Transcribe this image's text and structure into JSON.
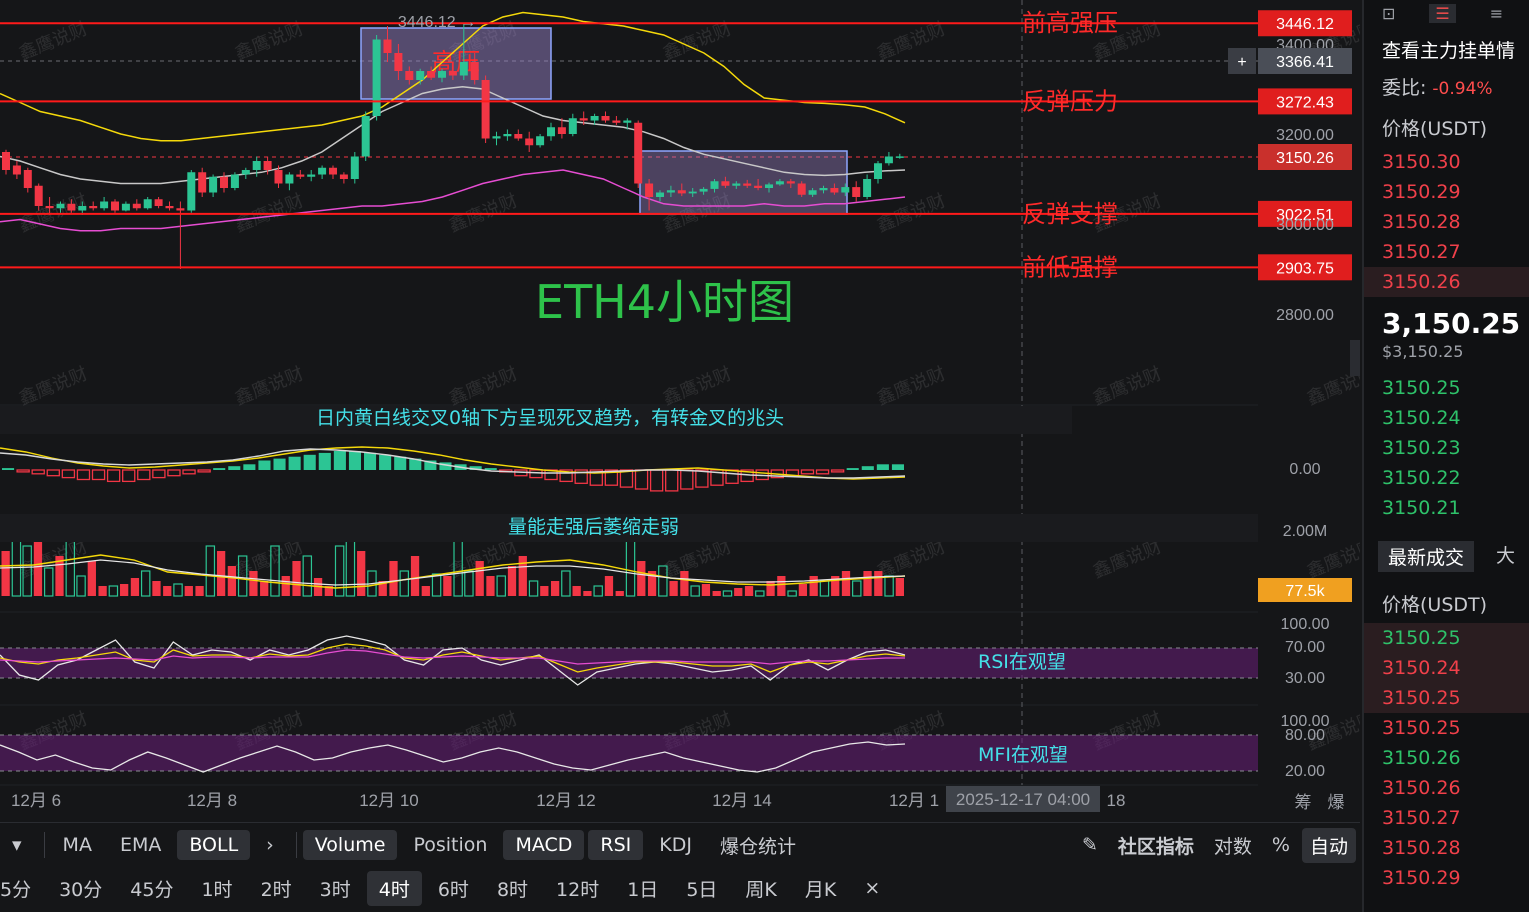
{
  "chart_data": {
    "type": "candlestick",
    "title": "ETH4小时图",
    "price_axis": {
      "ticks": [
        "3400.00",
        "3200.00",
        "3000.00",
        "2800.00"
      ]
    },
    "levels": [
      {
        "label": "前高强压",
        "price": 3446.12,
        "price_text": "3446.12"
      },
      {
        "label": "反弹压力",
        "price": 3272.43,
        "price_text": "3272.43"
      },
      {
        "label": "反弹支撑",
        "price": 3022.51,
        "price_text": "3022.51"
      },
      {
        "label": "前低强撑",
        "price": 2903.75,
        "price_text": "2903.75"
      }
    ],
    "current_price": "3150.26",
    "crosshair_price": "3366.41",
    "high_marker": "3446.12",
    "zones": [
      {
        "label": "高压"
      }
    ],
    "candles": [
      [
        3160,
        3165,
        3110,
        3120
      ],
      [
        3130,
        3140,
        3100,
        3110
      ],
      [
        3120,
        3125,
        3070,
        3080
      ],
      [
        3085,
        3090,
        3030,
        3040
      ],
      [
        3040,
        3060,
        3020,
        3035
      ],
      [
        3035,
        3050,
        3025,
        3045
      ],
      [
        3045,
        3055,
        3025,
        3030
      ],
      [
        3030,
        3050,
        3020,
        3040
      ],
      [
        3040,
        3050,
        3030,
        3035
      ],
      [
        3035,
        3060,
        3030,
        3050
      ],
      [
        3050,
        3055,
        3025,
        3030
      ],
      [
        3030,
        3050,
        3028,
        3045
      ],
      [
        3045,
        3055,
        3030,
        3035
      ],
      [
        3035,
        3060,
        3032,
        3055
      ],
      [
        3055,
        3060,
        3035,
        3040
      ],
      [
        3040,
        3050,
        3030,
        3035
      ],
      [
        3035,
        3050,
        2900,
        3030
      ],
      [
        3030,
        3120,
        3025,
        3115
      ],
      [
        3115,
        3125,
        3060,
        3070
      ],
      [
        3070,
        3110,
        3060,
        3105
      ],
      [
        3105,
        3115,
        3070,
        3080
      ],
      [
        3080,
        3115,
        3075,
        3110
      ],
      [
        3110,
        3125,
        3100,
        3120
      ],
      [
        3120,
        3150,
        3105,
        3140
      ],
      [
        3140,
        3150,
        3110,
        3120
      ],
      [
        3120,
        3130,
        3080,
        3090
      ],
      [
        3090,
        3115,
        3075,
        3110
      ],
      [
        3110,
        3120,
        3100,
        3105
      ],
      [
        3105,
        3120,
        3095,
        3110
      ],
      [
        3110,
        3130,
        3100,
        3125
      ],
      [
        3125,
        3130,
        3100,
        3110
      ],
      [
        3110,
        3115,
        3090,
        3100
      ],
      [
        3100,
        3160,
        3090,
        3150
      ],
      [
        3150,
        3250,
        3140,
        3240
      ],
      [
        3240,
        3420,
        3230,
        3410
      ],
      [
        3410,
        3440,
        3360,
        3380
      ],
      [
        3380,
        3400,
        3320,
        3340
      ],
      [
        3340,
        3350,
        3310,
        3320
      ],
      [
        3320,
        3345,
        3310,
        3340
      ],
      [
        3340,
        3350,
        3320,
        3325
      ],
      [
        3325,
        3345,
        3315,
        3340
      ],
      [
        3340,
        3360,
        3320,
        3330
      ],
      [
        3330,
        3446,
        3320,
        3360
      ],
      [
        3360,
        3380,
        3310,
        3320
      ],
      [
        3320,
        3330,
        3180,
        3190
      ],
      [
        3190,
        3205,
        3175,
        3195
      ],
      [
        3195,
        3210,
        3185,
        3200
      ],
      [
        3200,
        3210,
        3185,
        3190
      ],
      [
        3190,
        3205,
        3160,
        3175
      ],
      [
        3175,
        3200,
        3170,
        3195
      ],
      [
        3195,
        3225,
        3185,
        3215
      ],
      [
        3215,
        3235,
        3190,
        3200
      ],
      [
        3200,
        3245,
        3195,
        3235
      ],
      [
        3235,
        3250,
        3220,
        3230
      ],
      [
        3230,
        3245,
        3220,
        3240
      ],
      [
        3240,
        3250,
        3225,
        3230
      ],
      [
        3230,
        3240,
        3220,
        3225
      ],
      [
        3225,
        3235,
        3210,
        3230
      ],
      [
        3225,
        3230,
        3080,
        3090
      ],
      [
        3090,
        3100,
        3030,
        3060
      ],
      [
        3060,
        3075,
        3050,
        3070
      ],
      [
        3070,
        3085,
        3060,
        3075
      ],
      [
        3075,
        3090,
        3062,
        3068
      ],
      [
        3068,
        3080,
        3060,
        3072
      ],
      [
        3072,
        3082,
        3065,
        3078
      ],
      [
        3078,
        3100,
        3070,
        3095
      ],
      [
        3095,
        3105,
        3080,
        3085
      ],
      [
        3085,
        3095,
        3078,
        3090
      ],
      [
        3090,
        3098,
        3080,
        3085
      ],
      [
        3085,
        3100,
        3075,
        3080
      ],
      [
        3080,
        3092,
        3070,
        3088
      ],
      [
        3088,
        3100,
        3085,
        3095
      ],
      [
        3095,
        3100,
        3080,
        3090
      ],
      [
        3090,
        3095,
        3060,
        3065
      ],
      [
        3065,
        3080,
        3060,
        3075
      ],
      [
        3075,
        3085,
        3068,
        3080
      ],
      [
        3080,
        3090,
        3065,
        3070
      ],
      [
        3070,
        3090,
        3062,
        3082
      ],
      [
        3082,
        3095,
        3050,
        3060
      ],
      [
        3060,
        3110,
        3055,
        3100
      ],
      [
        3100,
        3140,
        3090,
        3135
      ],
      [
        3135,
        3160,
        3130,
        3150
      ],
      [
        3150,
        3156,
        3145,
        3150.26
      ]
    ],
    "boll_upper": [
      3290,
      3270,
      3250,
      3240,
      3230,
      3215,
      3200,
      3190,
      3185,
      3185,
      3190,
      3195,
      3200,
      3205,
      3210,
      3215,
      3220,
      3230,
      3240,
      3260,
      3290,
      3320,
      3360,
      3400,
      3440,
      3460,
      3470,
      3465,
      3460,
      3450,
      3445,
      3440,
      3430,
      3420,
      3400,
      3380,
      3350,
      3310,
      3280,
      3275,
      3270,
      3268,
      3265,
      3260,
      3245,
      3225
    ],
    "boll_mid": [
      3150,
      3140,
      3125,
      3110,
      3100,
      3095,
      3090,
      3090,
      3090,
      3095,
      3100,
      3105,
      3110,
      3115,
      3125,
      3140,
      3160,
      3190,
      3220,
      3250,
      3270,
      3290,
      3300,
      3305,
      3300,
      3280,
      3260,
      3240,
      3230,
      3225,
      3220,
      3215,
      3205,
      3190,
      3170,
      3155,
      3145,
      3135,
      3125,
      3115,
      3110,
      3108,
      3110,
      3115,
      3118,
      3120
    ],
    "boll_lower": [
      3005,
      3010,
      3000,
      2990,
      2985,
      2985,
      2990,
      2990,
      2990,
      2995,
      3000,
      3005,
      3010,
      3015,
      3020,
      3025,
      3030,
      3035,
      3040,
      3040,
      3045,
      3050,
      3060,
      3075,
      3090,
      3100,
      3110,
      3115,
      3120,
      3110,
      3100,
      3080,
      3060,
      3045,
      3040,
      3040,
      3040,
      3040,
      3045,
      3040,
      3040,
      3045,
      3045,
      3050,
      3055,
      3060
    ],
    "macd": {
      "zero_label": "0.00",
      "note": "日内黄白线交叉0轴下方呈现死叉趋势，有转金叉的兆头",
      "hist": [
        1,
        -1,
        -2,
        -3,
        -4,
        -5,
        -5,
        -6,
        -6,
        -5,
        -4,
        -3,
        -2,
        -1,
        1,
        2,
        3,
        5,
        6,
        7,
        8,
        9,
        10,
        10,
        9,
        8,
        7,
        6,
        5,
        4,
        3,
        2,
        1,
        -1,
        -3,
        -4,
        -5,
        -6,
        -7,
        -8,
        -8,
        -9,
        -10,
        -11,
        -11,
        -10,
        -9,
        -8,
        -7,
        -6,
        -5,
        -4,
        -3,
        -2,
        -2,
        -1,
        1,
        2,
        3,
        3
      ]
    },
    "volume": {
      "axis_label": "2.00M",
      "current": "77.5k",
      "note": "量能走强后萎缩走弱"
    },
    "rsi": {
      "ticks": [
        "100.00",
        "70.00",
        "30.00"
      ],
      "note": "RSI在观望"
    },
    "mfi": {
      "ticks": [
        "100.00",
        "80.00",
        "20.00"
      ],
      "note": "MFI在观望"
    },
    "x_labels": [
      "12月 6",
      "12月 8",
      "12月 10",
      "12月 12",
      "12月 14",
      "12月 1",
      "18"
    ],
    "crosshair_time": "2025-12-17 04:00",
    "watermark": "鑫鹰说财",
    "colors": {
      "up": "#2cc594",
      "down": "#f23645",
      "level": "#ff1a1a",
      "boll_upper": "#f5d90a",
      "boll_mid": "#c8c8c8",
      "boll_lower": "#e64dd2"
    }
  },
  "axis_corner": [
    "筹",
    "爆"
  ],
  "indicator_bar": {
    "items": [
      {
        "label": "MA",
        "active": false
      },
      {
        "label": "EMA",
        "active": false
      },
      {
        "label": "BOLL",
        "active": true
      },
      {
        "label": "Volume",
        "active": true
      },
      {
        "label": "Position",
        "active": false
      },
      {
        "label": "MACD",
        "active": true
      },
      {
        "label": "RSI",
        "active": true
      },
      {
        "label": "KDJ",
        "active": false
      },
      {
        "label": "爆仓统计",
        "active": false
      }
    ],
    "community": "社区指标",
    "log": "对数",
    "pct": "%",
    "auto": "自动"
  },
  "timeframes": {
    "items": [
      {
        "label": "5分",
        "active": false
      },
      {
        "label": "30分",
        "active": false
      },
      {
        "label": "45分",
        "active": false
      },
      {
        "label": "1时",
        "active": false
      },
      {
        "label": "2时",
        "active": false
      },
      {
        "label": "3时",
        "active": false
      },
      {
        "label": "4时",
        "active": true
      },
      {
        "label": "6时",
        "active": false
      },
      {
        "label": "8时",
        "active": false
      },
      {
        "label": "12时",
        "active": false
      },
      {
        "label": "1日",
        "active": false
      },
      {
        "label": "5日",
        "active": false
      },
      {
        "label": "周K",
        "active": false
      },
      {
        "label": "月K",
        "active": false
      }
    ],
    "close": "×"
  },
  "orderbook": {
    "title": "查看主力挂单情",
    "ratio_label": "委比:",
    "ratio_value": "-0.94%",
    "price_header": "价格(USDT)",
    "asks": [
      "3150.30",
      "3150.29",
      "3150.28",
      "3150.27",
      "3150.26"
    ],
    "last_price": "3,150.25",
    "last_usd": "$3,150.25",
    "bids": [
      "3150.25",
      "3150.24",
      "3150.23",
      "3150.22",
      "3150.21"
    ],
    "tab_active": "最新成交",
    "tab_other": "大",
    "trades_header": "价格(USDT)",
    "trades": [
      {
        "price": "3150.25",
        "side": "buy"
      },
      {
        "price": "3150.24",
        "side": "sell"
      },
      {
        "price": "3150.25",
        "side": "sell"
      },
      {
        "price": "3150.25",
        "side": "sell"
      },
      {
        "price": "3150.26",
        "side": "buy"
      },
      {
        "price": "3150.26",
        "side": "sell"
      },
      {
        "price": "3150.27",
        "side": "sell"
      },
      {
        "price": "3150.28",
        "side": "sell"
      },
      {
        "price": "3150.29",
        "side": "sell"
      }
    ]
  }
}
